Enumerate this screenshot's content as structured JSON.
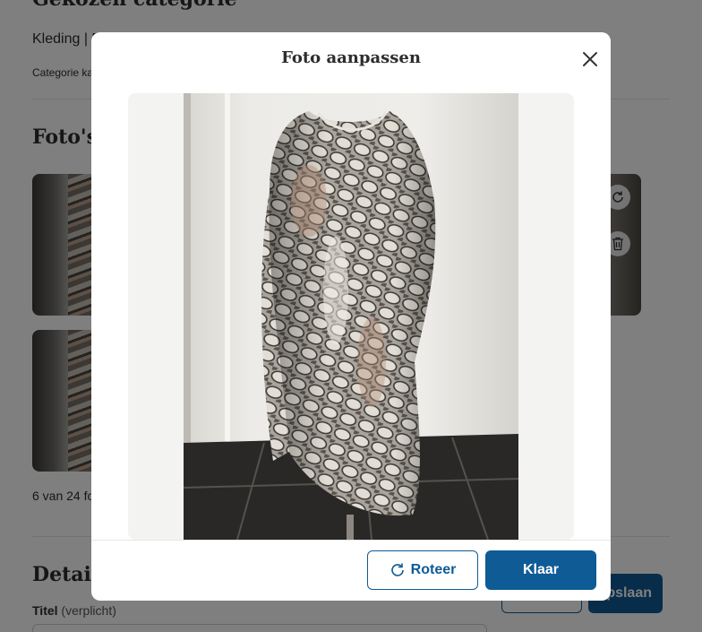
{
  "background": {
    "category_heading": "Gekozen categorie",
    "breadcrumb": "Kleding | D",
    "category_hint": "Categorie ka",
    "photos_heading": "Foto's",
    "photo_counter": "6 van 24 fo",
    "details_heading": "Details",
    "title_label": "Titel",
    "title_optional": "(verplicht)",
    "save_button_partial": "pslaan"
  },
  "modal": {
    "title": "Foto aanpassen",
    "close_icon": "close-icon",
    "rotate_button_label": "Roteer",
    "rotate_icon": "rotate-icon",
    "done_button_label": "Klaar"
  },
  "colors": {
    "primary": "#0e5b96",
    "overlay": "rgba(0,0,0,0.5)",
    "photo_backdrop": "#f3f3f2"
  }
}
